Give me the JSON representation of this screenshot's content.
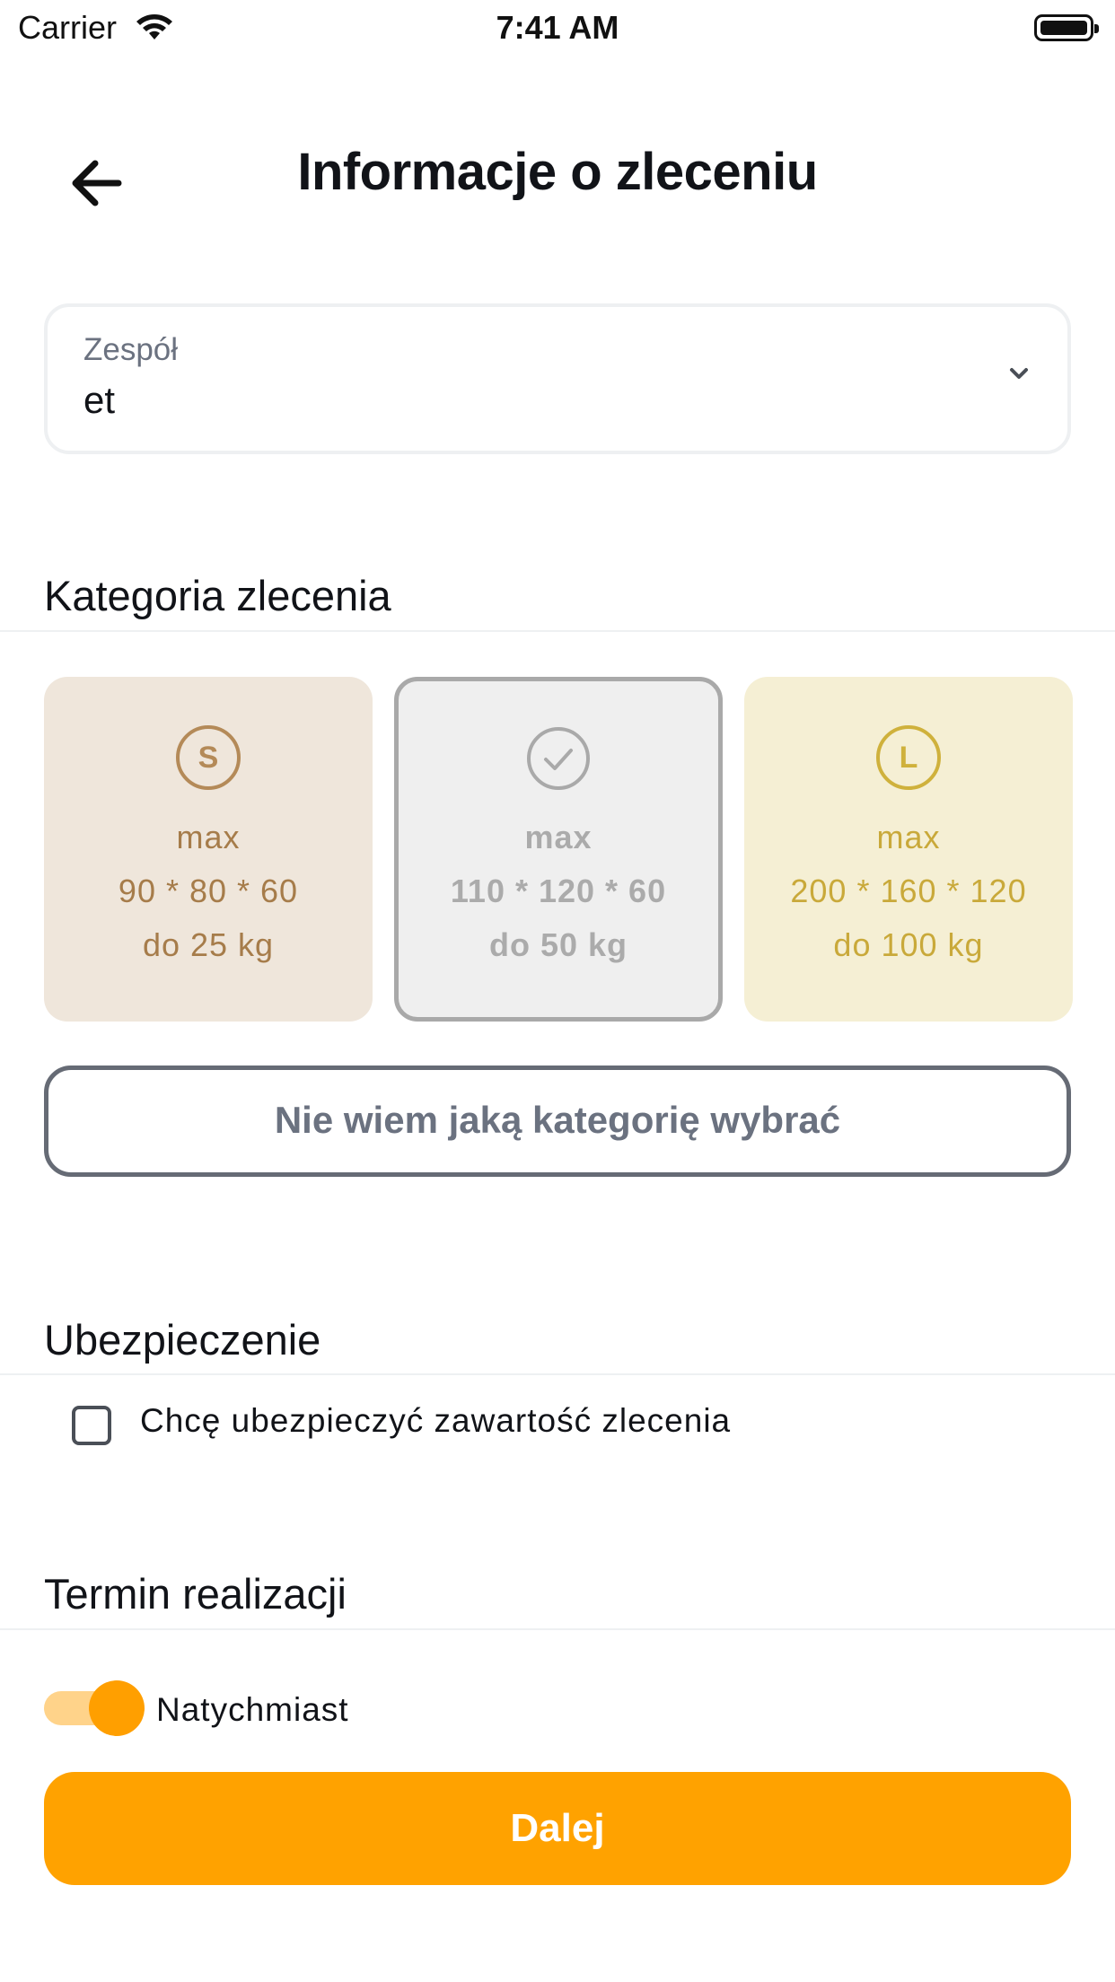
{
  "status_bar": {
    "carrier": "Carrier",
    "time": "7:41 AM"
  },
  "header": {
    "title": "Informacje o zleceniu",
    "back_icon": "arrow-left-icon"
  },
  "team_select": {
    "label": "Zespół",
    "value": "et",
    "icon": "chevron-down-icon"
  },
  "category_section": {
    "title": "Kategoria zlecenia",
    "cards": [
      {
        "badge": "S",
        "line1": "max",
        "line2": "90 * 80 * 60",
        "line3": "do 25 kg",
        "selected": false,
        "color": "#a67c4a"
      },
      {
        "badge_icon": "check-circle-icon",
        "line1": "max",
        "line2": "110 * 120 * 60",
        "line3": "do 50 kg",
        "selected": true,
        "color": "#ababab"
      },
      {
        "badge": "L",
        "line1": "max",
        "line2": "200 * 160 * 120",
        "line3": "do 100 kg",
        "selected": false,
        "color": "#c9a93a"
      }
    ],
    "help_button": "Nie wiem jaką kategorię wybrać"
  },
  "insurance_section": {
    "title": "Ubezpieczenie",
    "checkbox_label": "Chcę ubezpieczyć zawartość zlecenia",
    "checked": false
  },
  "deadline_section": {
    "title": "Termin realizacji",
    "toggle_label": "Natychmiast",
    "toggle_on": true
  },
  "primary_button": "Dalej",
  "colors": {
    "accent": "#ffa200",
    "toggle_track": "#ffd38a",
    "toggle_knob": "#ff9f00"
  }
}
